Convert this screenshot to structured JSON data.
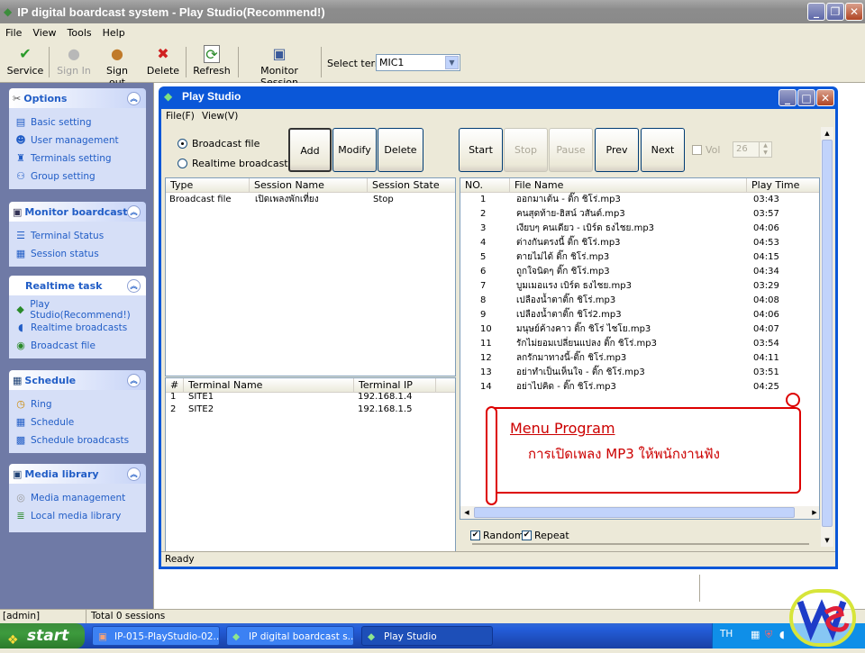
{
  "app": {
    "title": "IP digital boardcast system  -  Play Studio(Recommend!)"
  },
  "menu": [
    "File",
    "View",
    "Tools",
    "Help"
  ],
  "toolbar": {
    "service": "Service",
    "sign_in": "Sign In",
    "sign_out": "Sign out",
    "delete": "Delete",
    "refresh": "Refresh",
    "monitor": "Monitor Session",
    "select_term_label": "Select term",
    "select_term_value": "MIC1"
  },
  "sidebar": {
    "options": {
      "title": "Options",
      "items": [
        "Basic setting",
        "User management",
        "Terminals setting",
        "Group setting"
      ]
    },
    "monitor": {
      "title": "Monitor boardcast",
      "items": [
        "Terminal Status",
        "Session status"
      ]
    },
    "realtime": {
      "title": "Realtime task",
      "items": [
        "Play Studio(Recommend!)",
        "Realtime broadcasts",
        "Broadcast file"
      ]
    },
    "schedule": {
      "title": "Schedule",
      "items": [
        "Ring",
        "Schedule",
        "Schedule broadcasts"
      ]
    },
    "media": {
      "title": "Media library",
      "items": [
        "Media management",
        "Local media library"
      ]
    }
  },
  "play_studio": {
    "title": "Play Studio",
    "menu": [
      "File(F)",
      "View(V)"
    ],
    "radio_broadcast_file": "Broadcast file",
    "radio_realtime": "Realtime broadcast",
    "btn_add": "Add",
    "btn_modify": "Modify",
    "btn_delete": "Delete",
    "btn_start": "Start",
    "btn_stop": "Stop",
    "btn_pause": "Pause",
    "btn_prev": "Prev",
    "btn_next": "Next",
    "vol_label": "Vol",
    "vol_value": "26",
    "sessions": {
      "headers": [
        "Type",
        "Session Name",
        "Session State"
      ],
      "rows": [
        [
          "Broadcast file",
          "เปิดเพลงพักเที่ยง",
          "Stop"
        ]
      ]
    },
    "terminals": {
      "headers": [
        "#",
        "Terminal Name",
        "Terminal IP"
      ],
      "rows": [
        [
          "1",
          "SITE1",
          "192.168.1.4"
        ],
        [
          "2",
          "SITE2",
          "192.168.1.5"
        ]
      ]
    },
    "files": {
      "headers": [
        "NO.",
        "File Name",
        "Play Time"
      ],
      "rows": [
        [
          "1",
          "ออกมาเต้น - ติ๊ก ชิโร่.mp3",
          "03:43"
        ],
        [
          "2",
          "คนสุดท้าย-ฮิสน์ วสันต์.mp3",
          "03:57"
        ],
        [
          "3",
          "เงียบๆ คนเดียว - เบิร์ด ธงไชย.mp3",
          "04:06"
        ],
        [
          "4",
          "ต่างกันตรงนี้ ติ๊ก ชิโร่.mp3",
          "04:53"
        ],
        [
          "5",
          "ตายไม่ได้ ติ๊ก ชิโร่.mp3",
          "04:15"
        ],
        [
          "6",
          "ถูกใจนิดๆ ติ๊ก ชิโร่.mp3",
          "04:34"
        ],
        [
          "7",
          "บูมเมอแรง เบิร์ด ธงไชย.mp3",
          "03:29"
        ],
        [
          "8",
          "เปลืองน้ำตาติ๊ก ชิโร่.mp3",
          "04:08"
        ],
        [
          "9",
          "เปลืองน้ำตาติ๊ก ชิโร่2.mp3",
          "04:06"
        ],
        [
          "10",
          "มนุษย์ค้างคาว ติ๊ก ชิโร่ ไชโย.mp3",
          "04:07"
        ],
        [
          "11",
          "รักไม่ยอมเปลี่ยนแปลง ติ๊ก ชิโร่.mp3",
          "03:54"
        ],
        [
          "12",
          "ลกรักมาทางนี้-ติ๊ก ชิโร่.mp3",
          "04:11"
        ],
        [
          "13",
          "อย่าทำเป็นเห็นใจ - ติ๊ก ชิโร่.mp3",
          "03:51"
        ],
        [
          "14",
          "อย่าไปคิด - ติ๊ก ชิโร่.mp3",
          "04:25"
        ]
      ]
    },
    "random_label": "Random",
    "repeat_label": "Repeat",
    "status": "Ready"
  },
  "note": {
    "title": "Menu Program",
    "body": "การเปิดเพลง MP3 ให้พนักงานฟัง"
  },
  "statusbar": {
    "user": "[admin]",
    "sessions": "Total 0 sessions"
  },
  "taskbar": {
    "start": "start",
    "tasks": [
      "IP-015-PlayStudio-02...",
      "IP digital boardcast s...",
      "Play Studio"
    ],
    "lang": "TH"
  },
  "colors": {
    "xp_blue": "#0a57d8",
    "sidebar_bg": "#6f7aa6",
    "note_border": "#dd0000",
    "note_title": "#cc0000"
  }
}
